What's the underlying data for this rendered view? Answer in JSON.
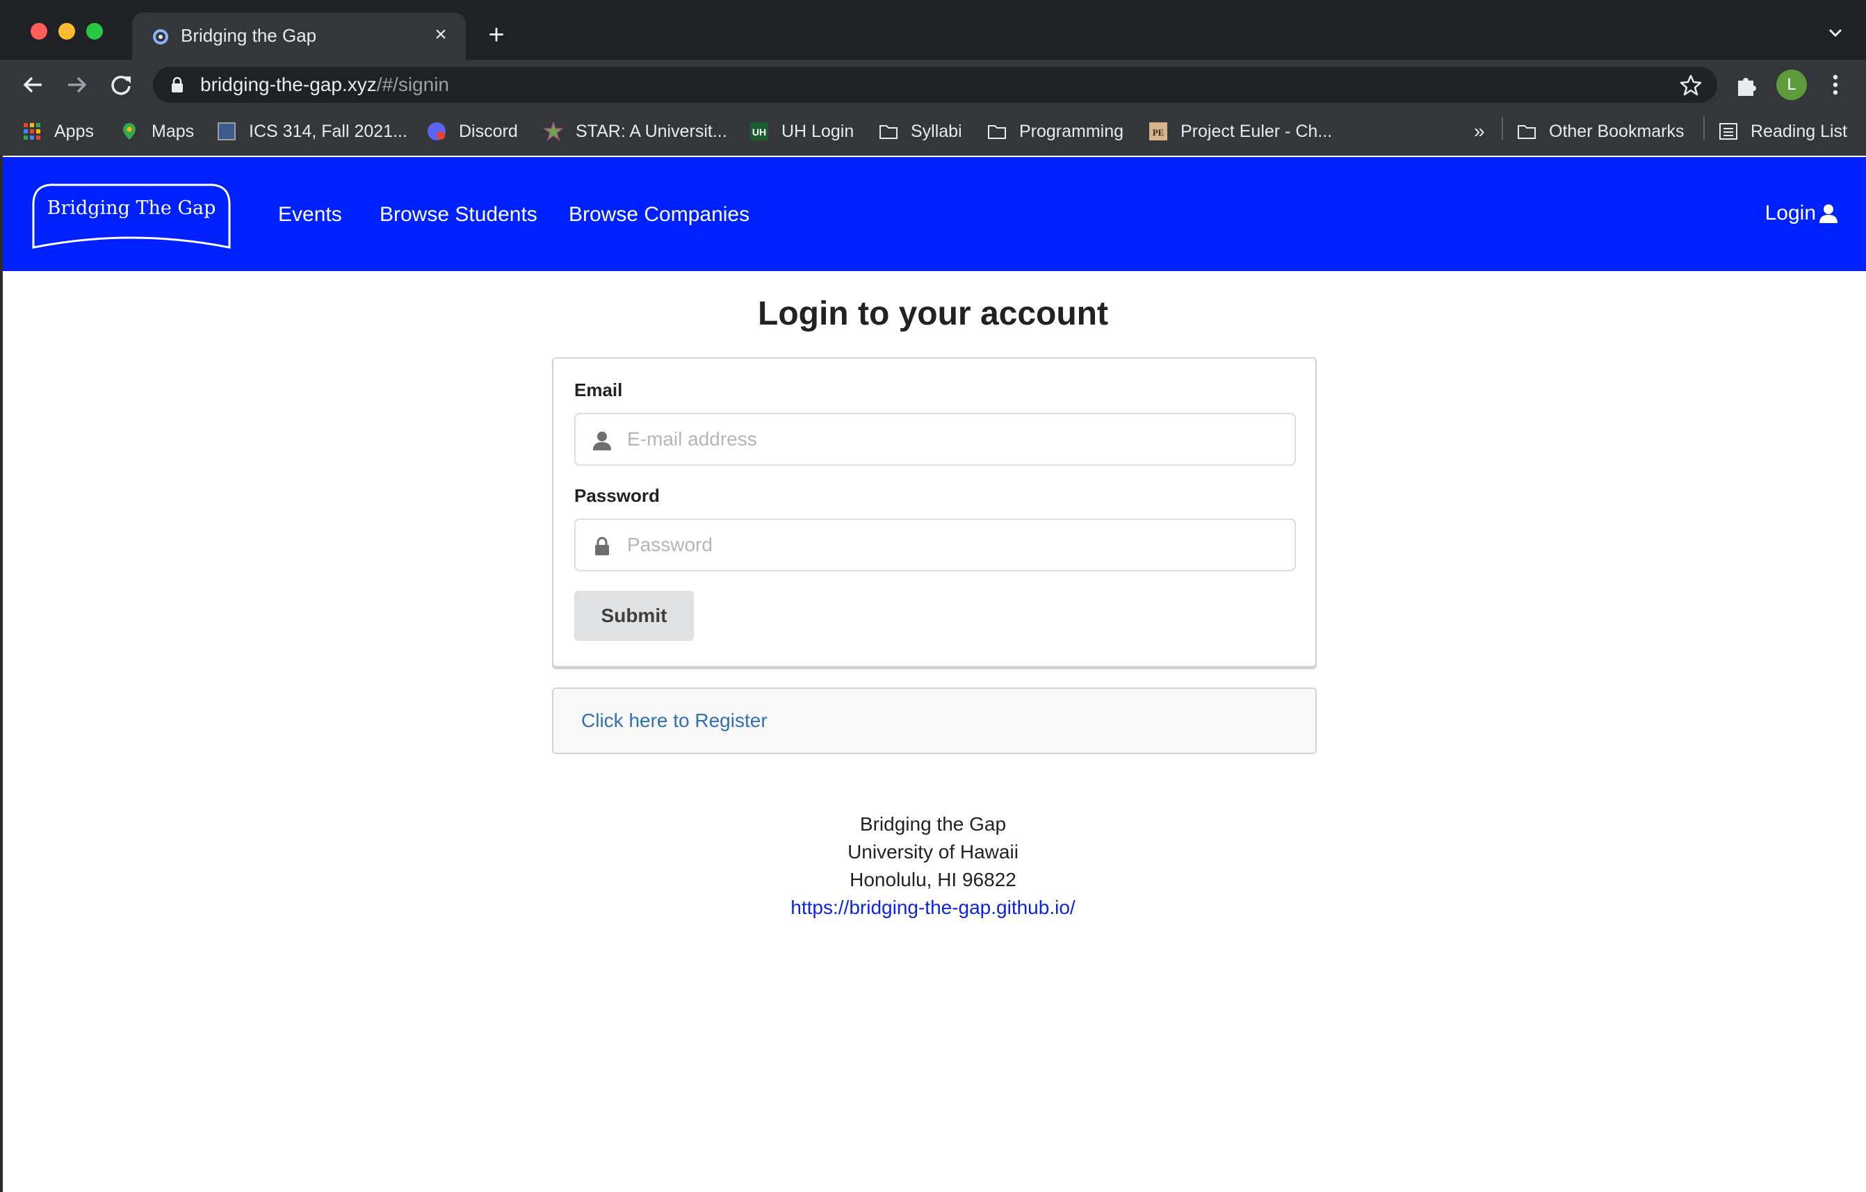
{
  "browser": {
    "tab_title": "Bridging the Gap",
    "url_host": "bridging-the-gap.xyz",
    "url_path": "/#/signin",
    "profile_initial": "L",
    "bookmarks": [
      {
        "label": "Apps",
        "icon": "apps-grid-icon"
      },
      {
        "label": "Maps",
        "icon": "maps-pin-icon"
      },
      {
        "label": "ICS 314, Fall 2021...",
        "icon": "page-icon"
      },
      {
        "label": "Discord",
        "icon": "discord-icon"
      },
      {
        "label": "STAR: A Universit...",
        "icon": "star-logo-icon"
      },
      {
        "label": "UH Login",
        "icon": "uh-icon"
      },
      {
        "label": "Syllabi",
        "icon": "folder-icon"
      },
      {
        "label": "Programming",
        "icon": "folder-icon"
      },
      {
        "label": "Project Euler - Ch...",
        "icon": "euler-icon"
      }
    ],
    "overflow_label": "»",
    "other_bookmarks": "Other Bookmarks",
    "reading_list": "Reading List"
  },
  "navbar": {
    "logo_text": "Bridging The Gap",
    "links": [
      "Events",
      "Browse Students",
      "Browse Companies"
    ],
    "login_label": "Login",
    "bg_color": "#0021ff"
  },
  "signin": {
    "title": "Login to your account",
    "email_label": "Email",
    "email_placeholder": "E-mail address",
    "password_label": "Password",
    "password_placeholder": "Password",
    "submit_label": "Submit",
    "register_link": "Click here to Register"
  },
  "footer": {
    "line1": "Bridging the Gap",
    "line2": "University of Hawaii",
    "line3": "Honolulu, HI 96822",
    "link": "https://bridging-the-gap.github.io/"
  }
}
